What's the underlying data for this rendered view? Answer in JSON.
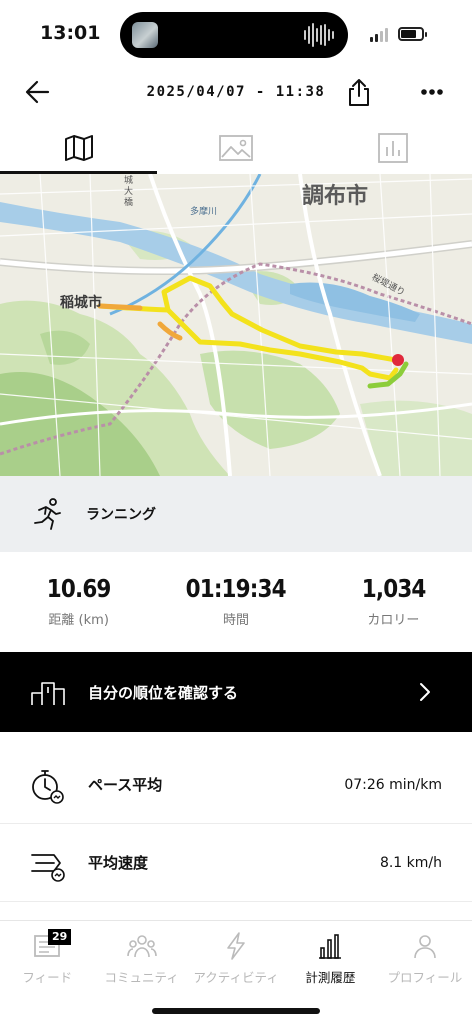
{
  "status_bar": {
    "time": "13:01"
  },
  "header": {
    "title": "2025/04/07 - 11:38"
  },
  "map": {
    "labels": {
      "city_chofu": "調布市",
      "city_inagi": "稲城市",
      "river_tama": "多摩川",
      "bridge": "城大橋",
      "road": "桜堤通り"
    }
  },
  "activity": {
    "type": "ランニング"
  },
  "stats": [
    {
      "value": "10.69",
      "label": "距離 (km)"
    },
    {
      "value": "01:19:34",
      "label": "時間"
    },
    {
      "value": "1,034",
      "label": "カロリー"
    }
  ],
  "ranking": {
    "label": "自分の順位を確認する"
  },
  "details": {
    "pace": {
      "label": "ペース平均",
      "value": "07:26 min/km"
    },
    "speed": {
      "label": "平均速度",
      "value": "8.1 km/h"
    }
  },
  "bottom_nav": {
    "feed": {
      "label": "フィード",
      "badge": "29"
    },
    "community": {
      "label": "コミュニティ"
    },
    "activity": {
      "label": "アクティビティ"
    },
    "history": {
      "label": "計測履歴"
    },
    "profile": {
      "label": "プロフィール"
    }
  },
  "colors": {
    "route_yellow": "#f3e21c",
    "route_orange": "#f0a83a",
    "route_green": "#8ccd3a",
    "end_marker": "#e0293c"
  }
}
